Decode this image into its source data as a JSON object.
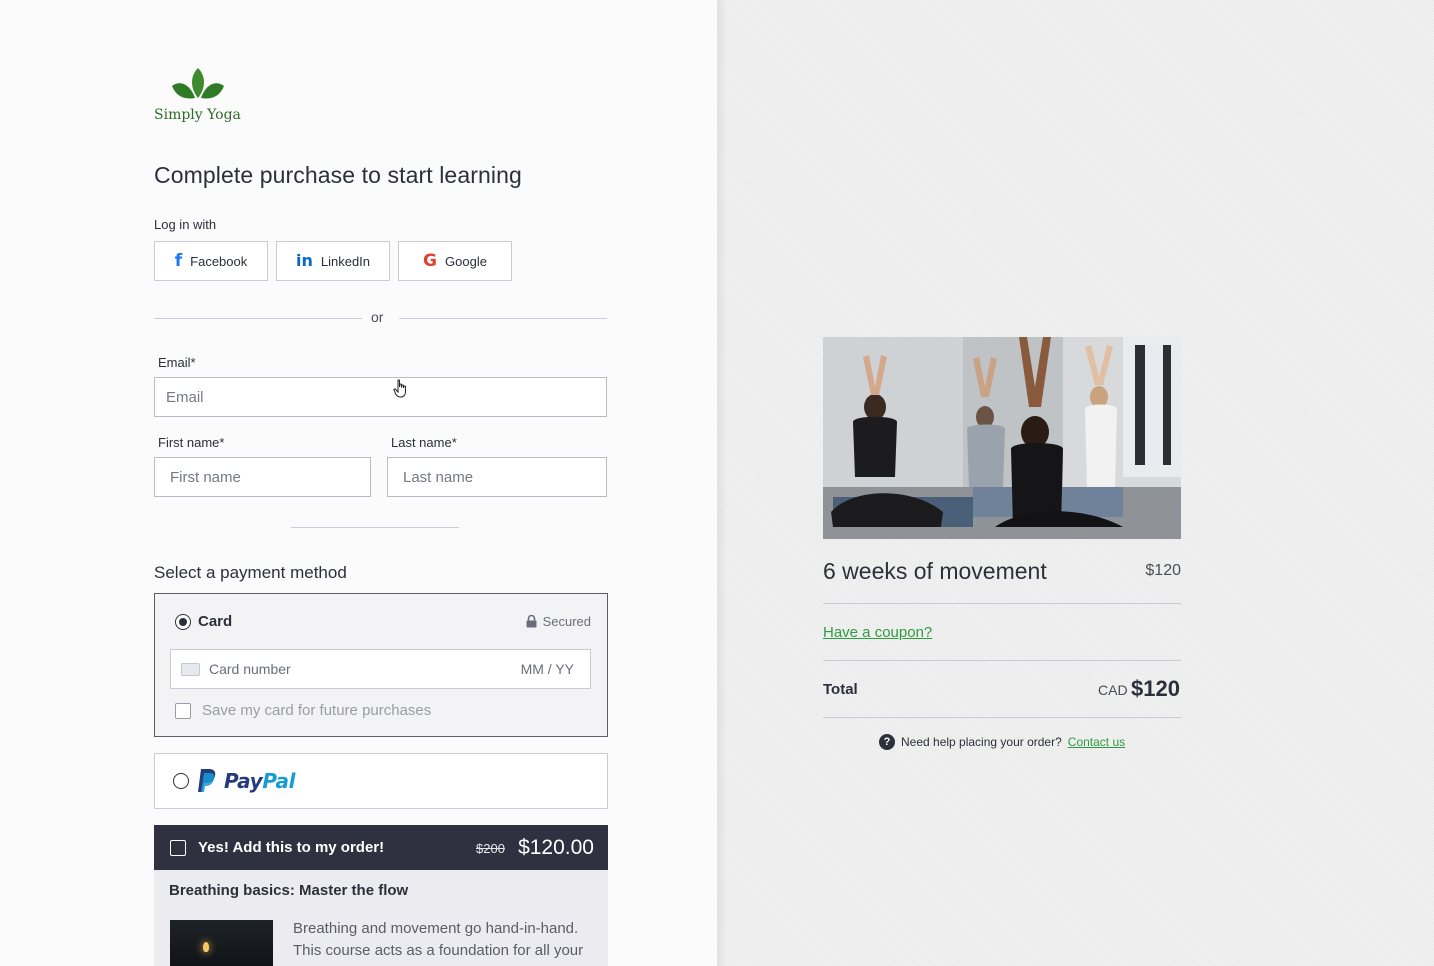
{
  "brand": {
    "name": "Simply Yoga",
    "color": "#2e6b2a"
  },
  "page_title": "Complete purchase to start learning",
  "login": {
    "label": "Log in with",
    "providers": [
      {
        "label": "Facebook",
        "icon": "facebook-icon"
      },
      {
        "label": "LinkedIn",
        "icon": "linkedin-icon"
      },
      {
        "label": "Google",
        "icon": "google-icon"
      }
    ],
    "or": "or"
  },
  "form": {
    "email_label": "Email*",
    "email_placeholder": "Email",
    "first_label": "First name*",
    "first_placeholder": "First name",
    "last_label": "Last name*",
    "last_placeholder": "Last name"
  },
  "payment": {
    "title": "Select a payment method",
    "card_label": "Card",
    "secured": "Secured",
    "card_number_placeholder": "Card number",
    "expiry_placeholder": "MM / YY",
    "save_card": "Save my card for future purchases",
    "card_selected": true,
    "paypal_pay": "Pay",
    "paypal_pal": "Pal"
  },
  "order_bump": {
    "checkbox_label": "Yes! Add this to my order!",
    "old_price": "$200",
    "price": "$120.00",
    "title": "Breathing basics: Master the flow",
    "description": "Breathing and movement go hand-in-hand. This course acts as a foundation for all your"
  },
  "summary": {
    "course_title": "6 weeks of movement",
    "course_price": "$120",
    "coupon": "Have a coupon?",
    "total_label": "Total",
    "currency": "CAD",
    "total": "$120",
    "help_text": "Need help placing your order?",
    "help_link": "Contact us"
  },
  "colors": {
    "accent_green": "#2f9b41",
    "dark": "#2f3140",
    "facebook": "#1877f2",
    "linkedin": "#0a66c2",
    "paypal_dark": "#253b80",
    "paypal_light": "#179bd7"
  }
}
